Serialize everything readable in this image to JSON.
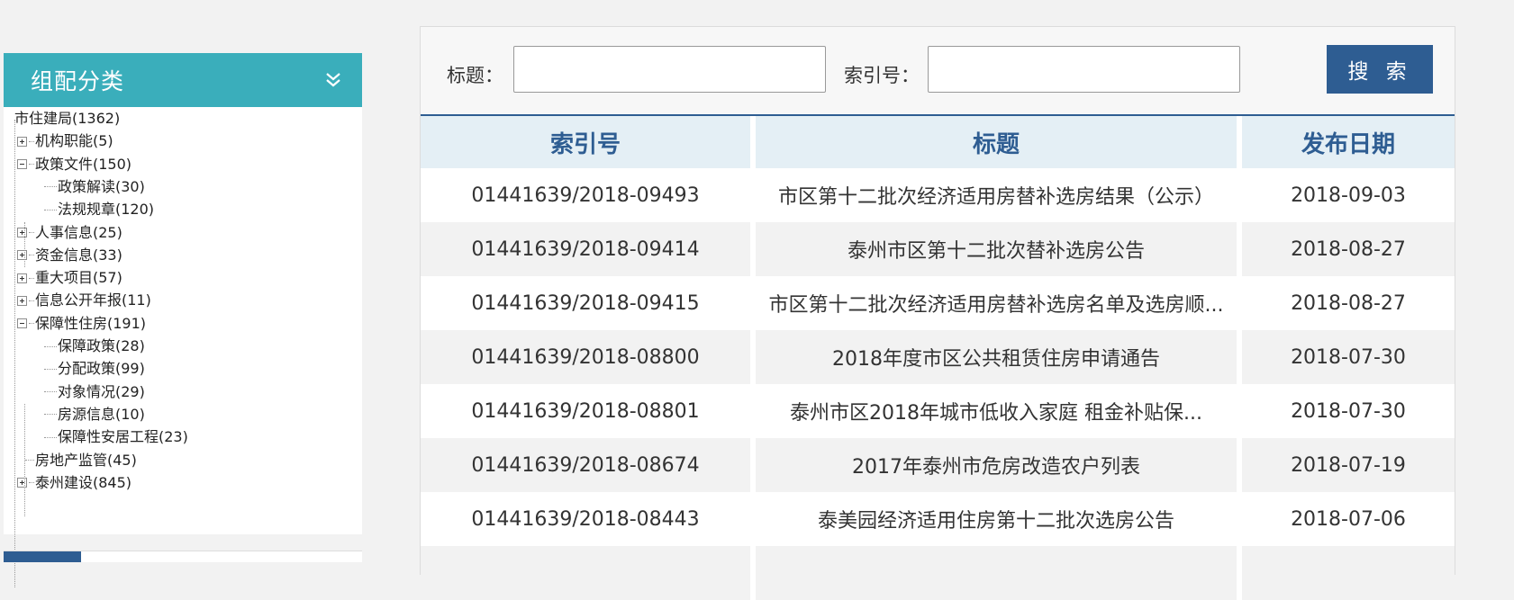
{
  "sidebar": {
    "title": "组配分类",
    "tree": [
      {
        "label": "市住建局(1362)",
        "level": 0,
        "toggle": "none"
      },
      {
        "label": "机构职能(5)",
        "level": 1,
        "toggle": "plus"
      },
      {
        "label": "政策文件(150)",
        "level": 1,
        "toggle": "minus"
      },
      {
        "label": "政策解读(30)",
        "level": 2,
        "toggle": "none"
      },
      {
        "label": "法规规章(120)",
        "level": 2,
        "toggle": "none"
      },
      {
        "label": "人事信息(25)",
        "level": 1,
        "toggle": "plus"
      },
      {
        "label": "资金信息(33)",
        "level": 1,
        "toggle": "plus"
      },
      {
        "label": "重大项目(57)",
        "level": 1,
        "toggle": "plus"
      },
      {
        "label": "信息公开年报(11)",
        "level": 1,
        "toggle": "plus"
      },
      {
        "label": "保障性住房(191)",
        "level": 1,
        "toggle": "minus"
      },
      {
        "label": "保障政策(28)",
        "level": 2,
        "toggle": "none"
      },
      {
        "label": "分配政策(99)",
        "level": 2,
        "toggle": "none"
      },
      {
        "label": "对象情况(29)",
        "level": 2,
        "toggle": "none"
      },
      {
        "label": "房源信息(10)",
        "level": 2,
        "toggle": "none"
      },
      {
        "label": "保障性安居工程(23)",
        "level": 2,
        "toggle": "none"
      },
      {
        "label": "房地产监管(45)",
        "level": 1,
        "toggle": "none"
      },
      {
        "label": "泰州建设(845)",
        "level": 1,
        "toggle": "plus"
      }
    ]
  },
  "search": {
    "title_label": "标题：",
    "title_value": "",
    "index_label": "索引号：",
    "index_value": "",
    "button_label": "搜 索"
  },
  "table": {
    "headers": [
      "索引号",
      "标题",
      "发布日期"
    ],
    "rows": [
      {
        "index": "01441639/2018-09493",
        "title": "市区第十二批次经济适用房替补选房结果（公示）",
        "date": "2018-09-03"
      },
      {
        "index": "01441639/2018-09414",
        "title": "泰州市区第十二批次替补选房公告",
        "date": "2018-08-27"
      },
      {
        "index": "01441639/2018-09415",
        "title": "市区第十二批次经济适用房替补选房名单及选房顺...",
        "date": "2018-08-27"
      },
      {
        "index": "01441639/2018-08800",
        "title": "2018年度市区公共租赁住房申请通告",
        "date": "2018-07-30"
      },
      {
        "index": "01441639/2018-08801",
        "title": "泰州市区2018年城市低收入家庭 租金补贴保...",
        "date": "2018-07-30"
      },
      {
        "index": "01441639/2018-08674",
        "title": "2017年泰州市危房改造农户列表",
        "date": "2018-07-19"
      },
      {
        "index": "01441639/2018-08443",
        "title": "泰美园经济适用住房第十二批次选房公告",
        "date": "2018-07-06"
      },
      {
        "index": "",
        "title": "",
        "date": ""
      }
    ]
  },
  "colors": {
    "sidebar_header": "#3aaebb",
    "accent_blue": "#2e5d92",
    "table_header_bg": "#e4eff5",
    "stripe": "#f2f2f2"
  },
  "icons": {
    "sidebar_toggle": "double-chevron-down-icon"
  }
}
